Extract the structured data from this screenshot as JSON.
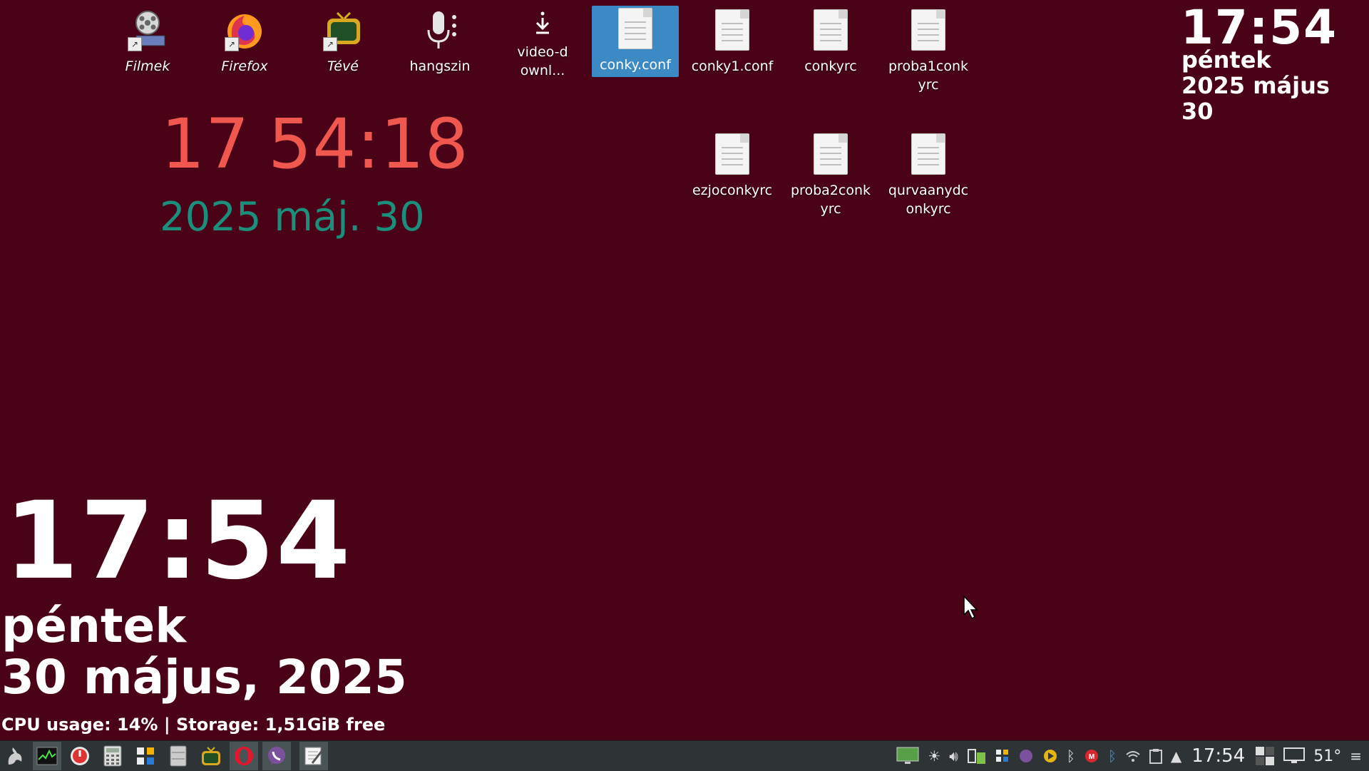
{
  "desktop": {
    "icons": [
      {
        "label": "Filmek",
        "icon": "film-reel-icon"
      },
      {
        "label": "Firefox",
        "icon": "firefox-icon"
      },
      {
        "label": "Tévé",
        "icon": "tv-icon"
      },
      {
        "label": "hangszin",
        "icon": "microphone-icon"
      },
      {
        "label": "video-downl...",
        "icon": "download-icon"
      },
      {
        "label": "conky.conf",
        "icon": "text-file-icon"
      },
      {
        "label": "conky1.conf",
        "icon": "text-file-icon"
      },
      {
        "label": "conkyrc",
        "icon": "text-file-icon"
      },
      {
        "label": "proba1conkyrc",
        "icon": "text-file-icon"
      },
      {
        "label": "ezjoconkyrc",
        "icon": "text-file-icon"
      },
      {
        "label": "proba2conkyrc",
        "icon": "text-file-icon"
      },
      {
        "label": "qurvaanydconkyrc",
        "icon": "text-file-icon"
      }
    ]
  },
  "conky_center": {
    "hour": "17",
    "min_sec": "54:18",
    "date": "2025 máj. 30"
  },
  "conky_top_right": {
    "time": "17:54",
    "day": "péntek",
    "date": "2025 május 30"
  },
  "conky_bottom_left": {
    "time": "17:54",
    "day": "péntek",
    "date": "30 május, 2025",
    "stats": "CPU usage: 14% | Storage: 1,51GiB free"
  },
  "taskbar": {
    "launchers": [
      "app-menu-icon",
      "system-monitor-icon",
      "power-icon",
      "calculator-icon",
      "widgets-icon",
      "file-cabinet-icon",
      "tv-icon",
      "opera-icon",
      "viber-icon",
      "text-editor-icon"
    ],
    "tray": [
      "display-icon",
      "brightness-icon",
      "volume-icon",
      "kdeconnect-icon",
      "apps-grid-icon",
      "viber-tray-icon",
      "media-player-icon",
      "bluetooth-icon",
      "mega-icon",
      "bluetooth-alt-icon",
      "wifi-icon",
      "clipboard-icon",
      "expand-arrow-icon"
    ],
    "clock": "17:54",
    "temperature": "51°"
  },
  "colors": {
    "background": "#4a0216",
    "conky_red": "#f0574f",
    "conky_teal": "#1b8e7c",
    "selection": "#3b8ac4",
    "taskbar": "#2e3436"
  }
}
